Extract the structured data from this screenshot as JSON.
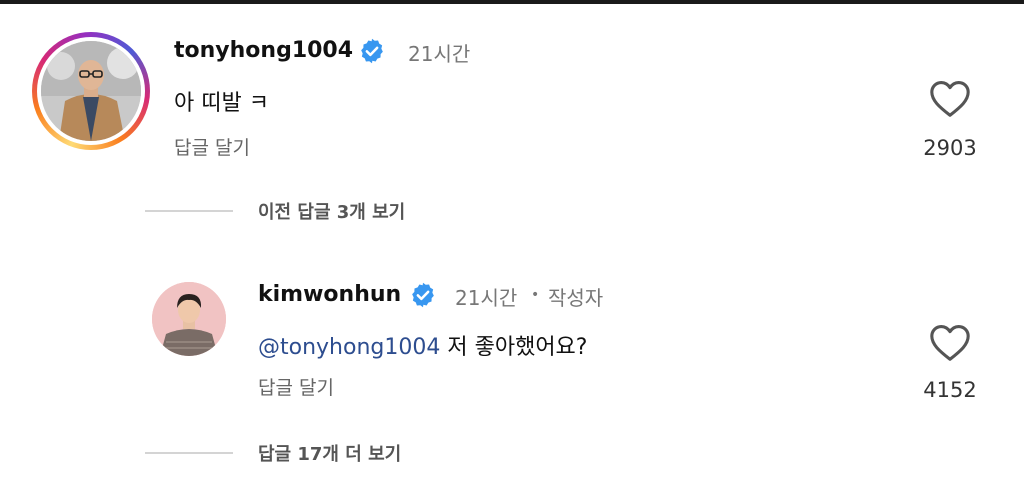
{
  "comments": [
    {
      "username": "tonyhong1004",
      "time": "21시간",
      "text": "아 띠발 ㅋ",
      "reply_label": "답글 달기",
      "like_count": "2903"
    },
    {
      "username": "kimwonhun",
      "time": "21시간",
      "author_badge": "작성자",
      "mention_symbol": "@",
      "mention": "tonyhong1004",
      "text": "저 좋아했어요?",
      "reply_label": "답글 달기",
      "like_count": "4152"
    }
  ],
  "view_previous_replies": "이전 답글 3개 보기",
  "view_more_replies": "답글 17개 더 보기",
  "colors": {
    "verified": "#3897f0",
    "mention": "#2d4d8f",
    "text_secondary": "#777777"
  },
  "icons": [
    "verified-badge-icon",
    "heart-icon",
    "threads-at-icon"
  ]
}
